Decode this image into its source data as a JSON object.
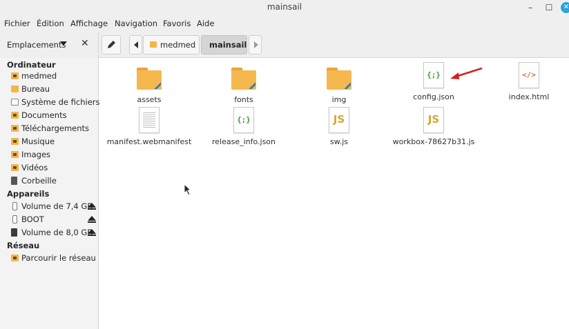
{
  "window": {
    "title": "mainsail"
  },
  "menu": [
    "Fichier",
    "Édition",
    "Affichage",
    "Navigation",
    "Favoris",
    "Aide"
  ],
  "places_header": {
    "label": "Emplacements"
  },
  "breadcrumb": [
    "medmed",
    "mainsail"
  ],
  "sidebar": {
    "sections": [
      {
        "title": "Ordinateur",
        "items": [
          {
            "label": "medmed",
            "icon": "home-folder-icon"
          },
          {
            "label": "Bureau",
            "icon": "desktop-folder-icon"
          },
          {
            "label": "Système de fichiers",
            "icon": "drive-icon"
          },
          {
            "label": "Documents",
            "icon": "documents-folder-icon"
          },
          {
            "label": "Téléchargements",
            "icon": "downloads-folder-icon"
          },
          {
            "label": "Musique",
            "icon": "music-folder-icon"
          },
          {
            "label": "Images",
            "icon": "pictures-folder-icon"
          },
          {
            "label": "Vidéos",
            "icon": "videos-folder-icon"
          },
          {
            "label": "Corbeille",
            "icon": "trash-icon"
          }
        ]
      },
      {
        "title": "Appareils",
        "items": [
          {
            "label": "Volume de 7,4 GB",
            "icon": "usb-drive-icon",
            "eject": true
          },
          {
            "label": "BOOT",
            "icon": "usb-drive-icon",
            "eject": true
          },
          {
            "label": "Volume de 8,0 GB",
            "icon": "sd-card-icon",
            "eject": true
          }
        ]
      },
      {
        "title": "Réseau",
        "items": [
          {
            "label": "Parcourir le réseau",
            "icon": "network-folder-icon"
          }
        ]
      }
    ]
  },
  "files": [
    {
      "name": "assets",
      "type": "folder"
    },
    {
      "name": "fonts",
      "type": "folder"
    },
    {
      "name": "img",
      "type": "folder"
    },
    {
      "name": "config.json",
      "type": "json",
      "glyph": "{;}"
    },
    {
      "name": "index.html",
      "type": "html",
      "glyph": "</>"
    },
    {
      "name": "manifest.webmanifest",
      "type": "text"
    },
    {
      "name": "release_info.json",
      "type": "json",
      "glyph": "{;}"
    },
    {
      "name": "sw.js",
      "type": "js",
      "glyph": "JS"
    },
    {
      "name": "workbox-78627b31.js",
      "type": "js",
      "glyph": "JS"
    }
  ],
  "annotation": {
    "color": "#d42020",
    "points_to": "config.json"
  },
  "colors": {
    "folder": "#f5b84f",
    "json": "#3c9a2f",
    "html": "#d96b2b",
    "js": "#d9a72c",
    "close_button": "#2aa3d8"
  }
}
